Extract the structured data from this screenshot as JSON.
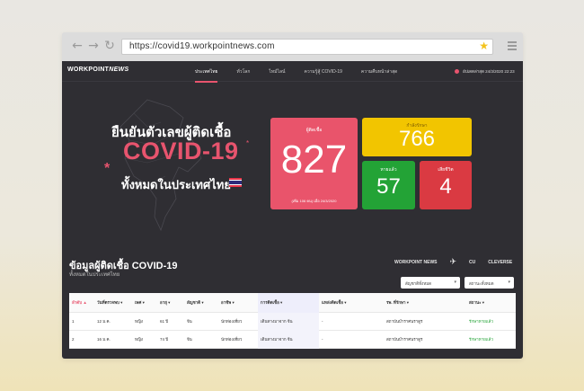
{
  "browser": {
    "url": "https://covid19.workpointnews.com",
    "back_icon": "←",
    "forward_icon": "→",
    "reload_icon": "↻",
    "star_icon": "★"
  },
  "header": {
    "logo_main": "WORKPOINT",
    "logo_italic": "NEWS",
    "nav": [
      "ประเทศไทย",
      "ทั่วโลก",
      "ไทม์ไลน์",
      "ความรู้สู้ COVID-19",
      "ความคืบหน้าล่าสุด"
    ],
    "updated": "อัปเดตล่าสุด 24/3/2020 22:23"
  },
  "hero": {
    "line1": "ยืนยันตัวเลขผู้ติดเชื้อ",
    "covid": "COVID-19",
    "asterisk": "*",
    "line3": "ทั้งหมดในประเทศไทย"
  },
  "stats": {
    "total_label": "ผู้ติดเชื้อ",
    "total_value": "827",
    "total_note": "(เพิ่ม 106 คน) เมื่อ 24/3/2020",
    "treat_label": "กำลังรักษา",
    "treat_value": "766",
    "recov_label": "หายแล้ว",
    "recov_value": "57",
    "death_label": "เสียชีวิต",
    "death_value": "4"
  },
  "colors": {
    "accent": "#e8546e",
    "treat": "#f2c500",
    "recovered": "#23a336",
    "death": "#da3a42",
    "background": "#2f2e33"
  },
  "data_section": {
    "title": "ข้อมูลผู้ติดเชื้อ COVID-19",
    "subtitle": "ทั้งหมดในประเทศไทย",
    "partners": [
      "WORKPOINT NEWS",
      "CU",
      "CLEVERSE"
    ],
    "filter_province": "สัญชาติทั้งหมด",
    "filter_status": "สถานะทั้งหมด",
    "caret_icon": "▾"
  },
  "table": {
    "headers": [
      "ลำดับ ▲",
      "วันที่ตรวจพบ ▾",
      "เพศ ▾",
      "อายุ ▾",
      "สัญชาติ ▾",
      "อาชีพ ▾",
      "การติดเชื้อ ▾",
      "แหล่งติดเชื้อ ▾",
      "รพ. ที่รักษา ▾",
      "สถานะ ▾"
    ],
    "rows": [
      [
        "1",
        "12 ม.ค.",
        "หญิง",
        "61 ปี",
        "จีน",
        "นักท่องเที่ยว",
        "เดินทางมาจาก จีน",
        "-",
        "สถาบันบำราศนราดูร",
        "รักษาหายแล้ว"
      ],
      [
        "2",
        "16 ม.ค.",
        "หญิง",
        "74 ปี",
        "จีน",
        "นักท่องเที่ยว",
        "เดินทางมาจาก จีน",
        "-",
        "สถาบันบำราศนราดูร",
        "รักษาหายแล้ว"
      ]
    ]
  }
}
